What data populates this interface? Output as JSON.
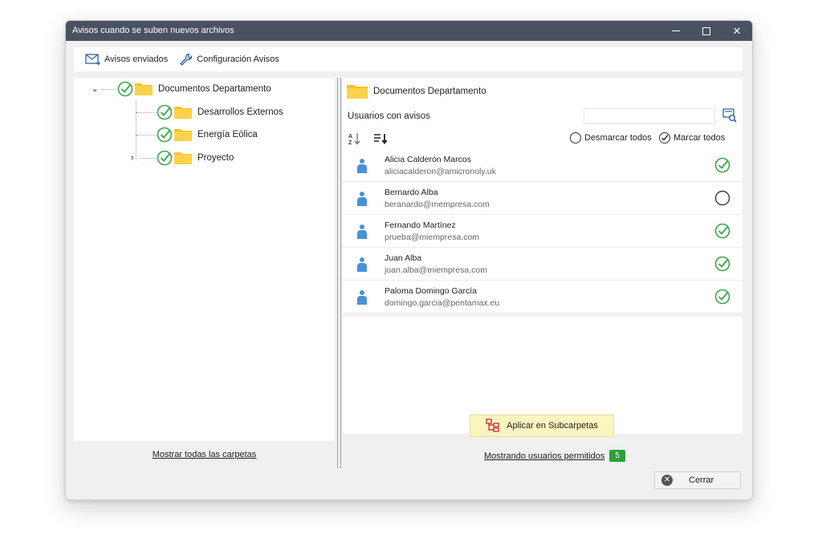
{
  "window": {
    "title": "Avisos cuando se suben nuevos archivos",
    "controls": {
      "minimize": "–",
      "maximize": "□",
      "close": "✕"
    }
  },
  "toolbar": {
    "sent_label": "Avisos enviados",
    "config_label": "Configuración Avisos"
  },
  "tree": {
    "root": "Documentos Departamento",
    "children": [
      "Desarrollos Externos",
      "Energía Eólica",
      "Proyecto"
    ],
    "show_all_link": "Mostrar todas las carpetas"
  },
  "right": {
    "folder_title": "Documentos Departamento",
    "users_label": "Usuarios con avisos",
    "search_value": "",
    "unmark_all": "Desmarcar todos",
    "mark_all": "Marcar todos",
    "users": [
      {
        "name": "Alicia Calderón Marcos",
        "email": "aliciacalderon@amicronoly.uk",
        "checked": true
      },
      {
        "name": "Bernardo Alba",
        "email": "beranardo@mempresa.com",
        "checked": false
      },
      {
        "name": "Fernando Martínez",
        "email": "prueba@miempresa.com",
        "checked": true
      },
      {
        "name": "Juan Alba",
        "email": "juan.alba@miempresa.com",
        "checked": true
      },
      {
        "name": "Paloma Domingo García",
        "email": "domingo.garcia@pentamax.eu",
        "checked": true
      }
    ],
    "apply_button": "Aplicar en Subcarpetas",
    "showing_link": "Mostrando usuarios permitidos",
    "showing_count": "5"
  },
  "footer": {
    "close_label": "Cerrar"
  },
  "colors": {
    "titlebar": "#4a5262",
    "check_green": "#3aa94a",
    "folder_yellow": "#f8c22a",
    "badge_green": "#2f9e3a",
    "apply_bg": "#fdf5c0"
  },
  "icons": {
    "sent": "envelope-icon",
    "config": "wrench-icon",
    "check": "check-circle-icon",
    "folder": "folder-icon",
    "sort_az": "sort-az-icon",
    "sort_list": "sort-list-icon",
    "user": "user-icon",
    "search": "search-icon",
    "apply": "tree-icon",
    "close": "close-circle-icon"
  }
}
